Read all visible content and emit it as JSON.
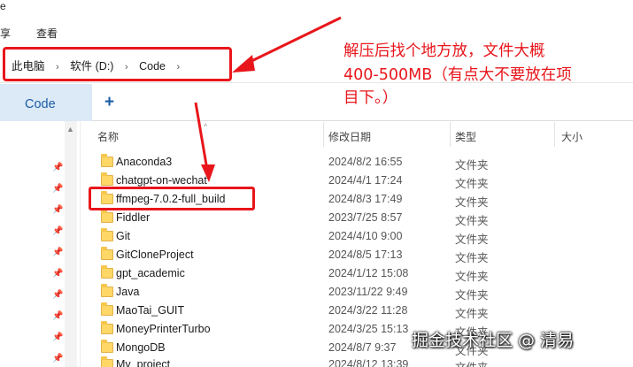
{
  "window": {
    "title_fragment": "e"
  },
  "ribbon": {
    "tabs": [
      "享",
      "查看"
    ]
  },
  "address_bar": {
    "crumbs": [
      "此电脑",
      "软件 (D:)",
      "Code"
    ],
    "separator": "›"
  },
  "tab_bar": {
    "active_tab": "Code",
    "new_tab": "+"
  },
  "columns": {
    "name": "名称",
    "modified": "修改日期",
    "type": "类型",
    "size": "大小"
  },
  "files": [
    {
      "name": "Anaconda3",
      "date": "2024/8/2 16:55",
      "type": "文件夹"
    },
    {
      "name": "chatgpt-on-wechat",
      "date": "2024/4/1 17:24",
      "type": "文件夹"
    },
    {
      "name": "ffmpeg-7.0.2-full_build",
      "date": "2024/8/3 17:49",
      "type": "文件夹"
    },
    {
      "name": "Fiddler",
      "date": "2023/7/25 8:57",
      "type": "文件夹"
    },
    {
      "name": "Git",
      "date": "2024/4/10 9:00",
      "type": "文件夹"
    },
    {
      "name": "GitCloneProject",
      "date": "2024/8/5 17:13",
      "type": "文件夹"
    },
    {
      "name": "gpt_academic",
      "date": "2024/1/12 15:08",
      "type": "文件夹"
    },
    {
      "name": "Java",
      "date": "2023/11/22 9:49",
      "type": "文件夹"
    },
    {
      "name": "MaoTai_GUIT",
      "date": "2024/3/22 11:28",
      "type": "文件夹"
    },
    {
      "name": "MoneyPrinterTurbo",
      "date": "2024/3/25 15:13",
      "type": "文件夹"
    },
    {
      "name": "MongoDB",
      "date": "2024/8/7 9:37",
      "type": "文件夹"
    },
    {
      "name": "My_project",
      "date": "2024/8/12 13:39",
      "type": "文件夹"
    }
  ],
  "annotation": {
    "lines": [
      "解压后找个地方放，文件大概",
      "400-500MB（有点大不要放在项",
      "目下。）"
    ],
    "color": "#e8161b"
  },
  "watermark": "掘金技术社区 @ 清易",
  "colors": {
    "accent": "#1c5ea4",
    "tab_active_bg": "#dce9f6",
    "folder": "#ffd767"
  },
  "icons": {
    "folder": "folder-icon",
    "pin": "pin-icon",
    "arrow": "chevron-right-icon"
  }
}
